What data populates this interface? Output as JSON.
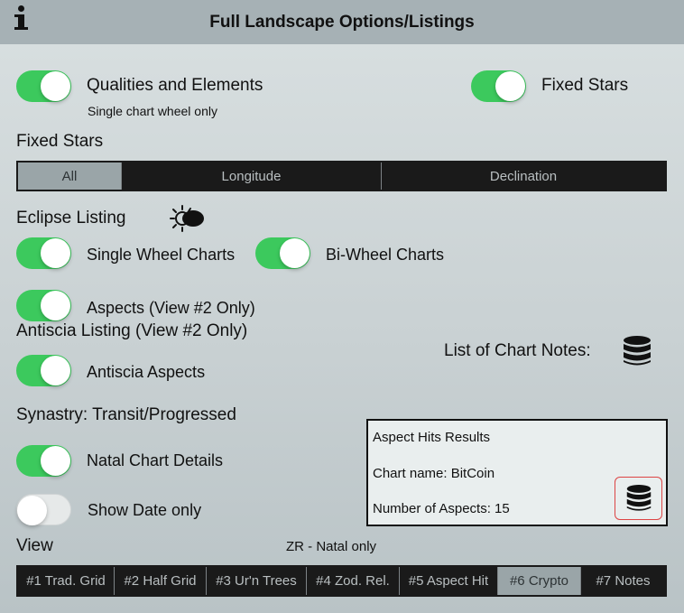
{
  "header": {
    "title": "Full Landscape Options/Listings",
    "info_icon": "info-icon"
  },
  "qualities": {
    "label": "Qualities and Elements",
    "sublabel": "Single chart wheel only",
    "on": true
  },
  "fixed_stars_toggle": {
    "label": "Fixed Stars",
    "on": true
  },
  "fixed_stars_section": {
    "title": "Fixed Stars",
    "segments": [
      "All",
      "Longitude",
      "Declination"
    ],
    "selected": "All"
  },
  "eclipse": {
    "title": "Eclipse Listing",
    "icon": "eclipse-icon",
    "single_wheel": {
      "label": "Single Wheel Charts",
      "on": true
    },
    "bi_wheel": {
      "label": "Bi-Wheel Charts",
      "on": true
    },
    "aspects": {
      "label": "Aspects (View #2 Only)",
      "on": true
    }
  },
  "antiscia": {
    "title": "Antiscia Listing (View #2 Only)",
    "aspects": {
      "label": "Antiscia Aspects",
      "on": true
    }
  },
  "chart_notes": {
    "label": "List of Chart Notes:",
    "icon": "database-icon"
  },
  "synastry": {
    "title": "Synastry: Transit/Progressed",
    "natal_details": {
      "label": "Natal Chart Details",
      "on": true
    },
    "show_date": {
      "label": "Show Date only",
      "on": false
    }
  },
  "aspect_hits": {
    "title": "Aspect Hits Results",
    "chart_name": "Chart name: BitCoin",
    "count": "Number of Aspects: 15",
    "button_icon": "database-icon"
  },
  "view": {
    "title": "View",
    "note": "ZR - Natal only",
    "tabs": [
      "#1 Trad. Grid",
      "#2 Half Grid",
      "#3 Ur'n Trees",
      "#4 Zod. Rel.",
      "#5 Aspect Hit",
      "#6 Crypto",
      "#7 Notes"
    ],
    "selected": "#6 Crypto"
  },
  "colors": {
    "toggle_on": "#3cc95d",
    "toggle_off": "#e6e9e9",
    "segment_bg": "#1a1a1a",
    "segment_active": "#9aa5a8",
    "title_bar": "#a6b1b5"
  }
}
